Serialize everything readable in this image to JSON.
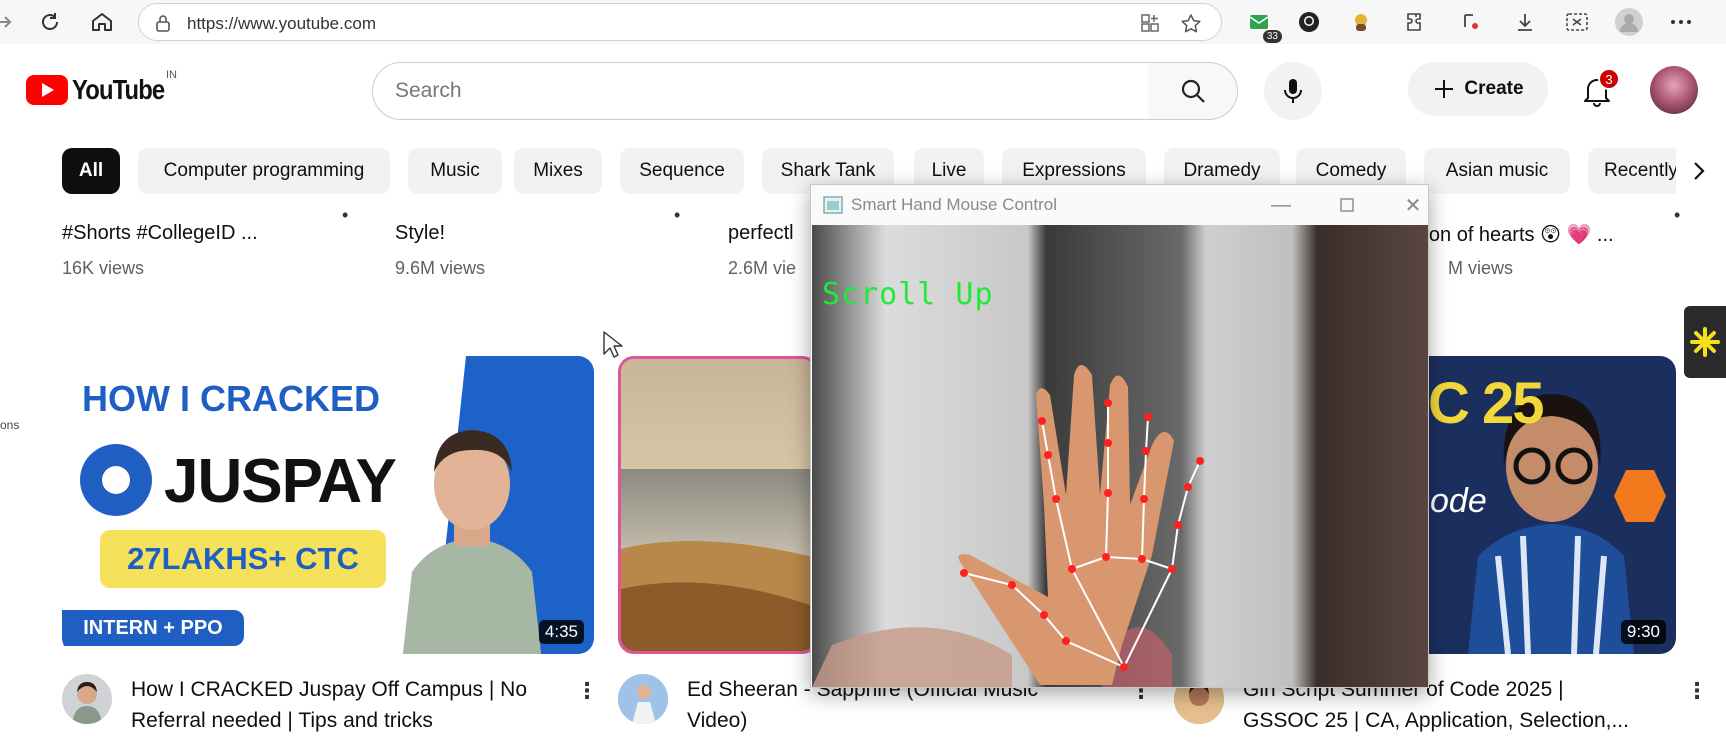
{
  "browser": {
    "url": "https://www.youtube.com",
    "extension_badge": "33"
  },
  "header": {
    "logo_text": "YouTube",
    "region": "IN",
    "search_placeholder": "Search",
    "create_label": "Create",
    "notification_count": "3"
  },
  "chips": [
    "All",
    "Computer programming",
    "Music",
    "Mixes",
    "Sequence",
    "Shark Tank",
    "Live",
    "Expressions",
    "Dramedy",
    "Comedy",
    "Asian music",
    "Recently"
  ],
  "top_row": [
    {
      "title_tail": "#Shorts #CollegeID ...",
      "views": "16K views"
    },
    {
      "title_tail": "Style!",
      "views": "9.6M views"
    },
    {
      "title_tail": "perfectl",
      "views": "2.6M vie"
    },
    {
      "title_tail": "lion of hearts 😲 💗 ...",
      "views": "M views"
    }
  ],
  "videos": [
    {
      "title_line1": "How I CRACKED Juspay Off Campus | No",
      "title_line2": "Referral needed | Tips and tricks",
      "duration": "4:35",
      "thumb": {
        "headline": "HOW I CRACKED",
        "brand": "JUSPAY",
        "ctc": "27LAKHS+ CTC",
        "tag": "INTERN + PPO"
      }
    },
    {
      "title_line1": "Ed Sheeran - Sapphire (Official Music",
      "title_line2": "Video)"
    },
    {
      "title_line1": "Girl Script Summer of Code 2025 |",
      "title_line2": "GSSOC 25 | CA, Application, Selection,...",
      "duration": "9:30",
      "thumb": {
        "text1": "C 25",
        "text2": "ode"
      }
    }
  ],
  "overlay_window": {
    "title": "Smart Hand Mouse Control",
    "gesture_label": "Scroll Up"
  },
  "left_stub_text": "ons"
}
